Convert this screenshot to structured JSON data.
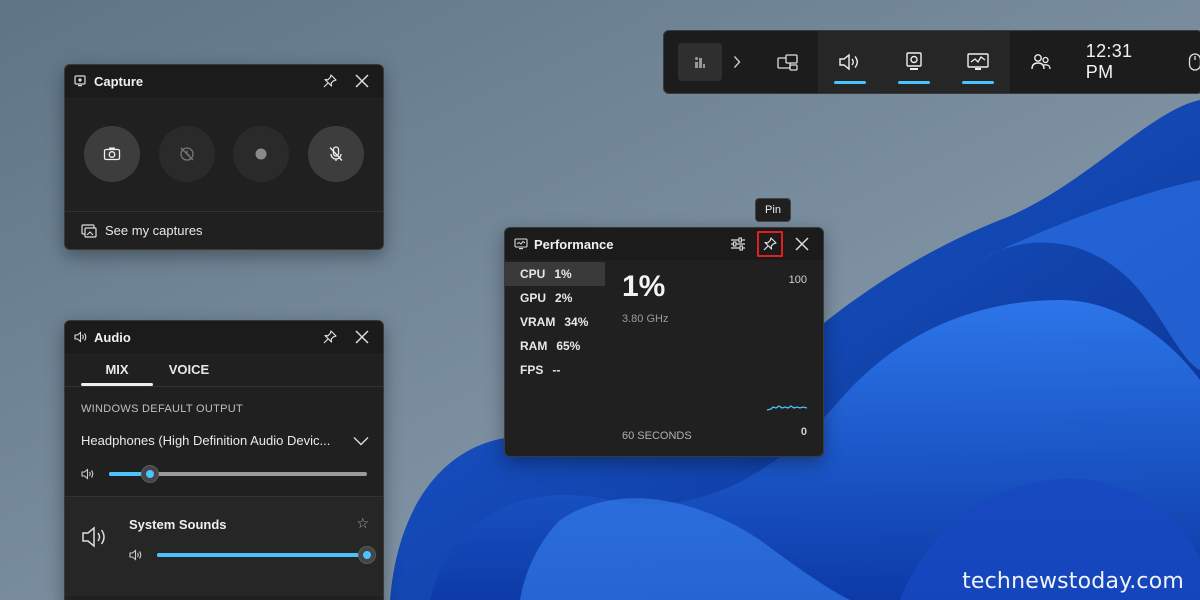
{
  "capture": {
    "title": "Capture",
    "buttons": [
      "screenshot",
      "record-last",
      "start-recording",
      "mic-toggle"
    ],
    "see_captures": "See my captures"
  },
  "audio": {
    "title": "Audio",
    "tabs": [
      "MIX",
      "VOICE"
    ],
    "active_tab": "MIX",
    "output_label": "WINDOWS DEFAULT OUTPUT",
    "device": "Headphones (High Definition Audio Devic...",
    "device_volume_fraction": 0.16,
    "system_sounds": {
      "label": "System Sounds",
      "volume_fraction": 1.0
    }
  },
  "performance": {
    "title": "Performance",
    "metrics": [
      {
        "key": "CPU",
        "value": "1%"
      },
      {
        "key": "GPU",
        "value": "2%"
      },
      {
        "key": "VRAM",
        "value": "34%"
      },
      {
        "key": "RAM",
        "value": "65%"
      },
      {
        "key": "FPS",
        "value": "--"
      }
    ],
    "selected_metric": "CPU",
    "big_value": "1%",
    "clock": "3.80 GHz",
    "max": "100",
    "min": "0",
    "window": "60 SECONDS",
    "tooltip": "Pin"
  },
  "gamebar": {
    "time": "12:31 PM",
    "buttons": [
      "widget-menu",
      "audio",
      "capture",
      "performance",
      "social"
    ]
  },
  "colors": {
    "accent": "#4cc2ff",
    "highlight": "#e02020",
    "panel": "#202020"
  },
  "watermark": "technewstoday.com"
}
